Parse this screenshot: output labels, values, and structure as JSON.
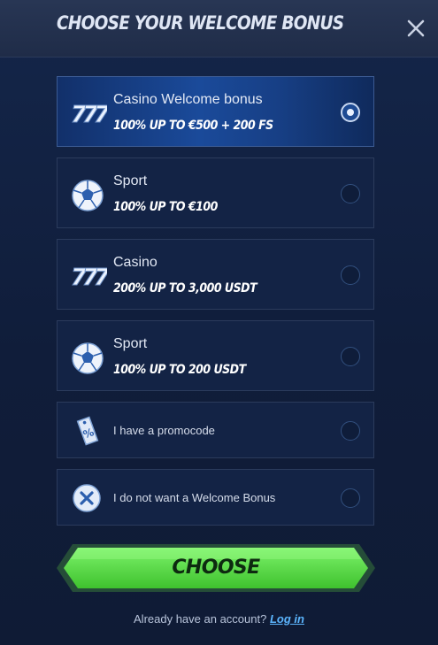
{
  "header": {
    "title": "CHOOSE YOUR WELCOME BONUS"
  },
  "options": [
    {
      "name": "Casino Welcome bonus",
      "offer": "100% UP TO €500 + 200 FS",
      "icon": "slot-777-icon",
      "selected": true
    },
    {
      "name": "Sport",
      "offer": "100% UP TO €100",
      "icon": "soccer-ball-icon",
      "selected": false
    },
    {
      "name": "Casino",
      "offer": "200% UP TO 3,000 USDT",
      "icon": "slot-777-icon",
      "selected": false
    },
    {
      "name": "Sport",
      "offer": "100% UP TO 200 USDT",
      "icon": "soccer-ball-icon",
      "selected": false
    },
    {
      "name": "I have a promocode",
      "icon": "promo-tag-icon",
      "selected": false
    },
    {
      "name": "I do not want a Welcome Bonus",
      "icon": "no-bonus-x-icon",
      "selected": false
    }
  ],
  "choose_button": {
    "label": "CHOOSE"
  },
  "footer": {
    "text": "Already have an account?",
    "login_label": "Log in"
  },
  "colors": {
    "accent_green": "#5ee04a",
    "selected_blue": "#1a4a9a",
    "link": "#5cb6ff"
  }
}
